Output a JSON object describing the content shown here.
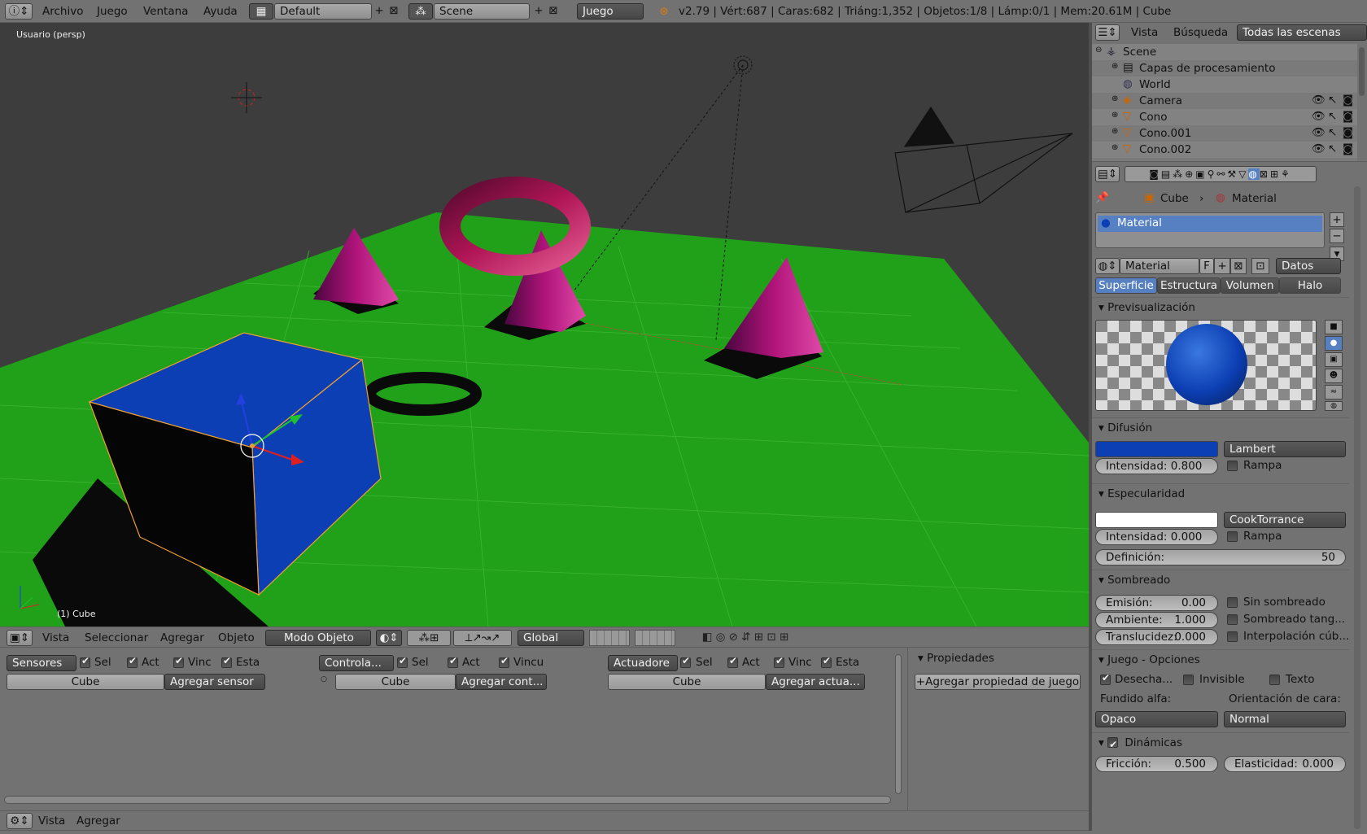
{
  "topbar": {
    "menus": [
      "Archivo",
      "Juego",
      "Ventana",
      "Ayuda"
    ],
    "layout": "Default",
    "scene": "Scene",
    "engine": "Juego",
    "stats": "v2.79 | Vért:687 | Caras:682 | Triáng:1,352 | Objetos:1/8 | Lámp:0/1 | Mem:20.61M | Cube"
  },
  "viewport": {
    "view_label": "Usuario (persp)",
    "object_label": "(1) Cube"
  },
  "view3d_header": {
    "menus": [
      "Vista",
      "Seleccionar",
      "Agregar",
      "Objeto"
    ],
    "mode": "Modo Objeto",
    "orientation": "Global"
  },
  "logic": {
    "sensors": {
      "type": "Sensores",
      "checks": [
        "Sel",
        "Act",
        "Vinc",
        "Esta"
      ],
      "object": "Cube",
      "add": "Agregar sensor"
    },
    "controllers": {
      "type": "Controla...",
      "checks": [
        "Sel",
        "Act",
        "Vincu"
      ],
      "object": "Cube",
      "add": "Agregar cont..."
    },
    "actuators": {
      "type": "Actuadore",
      "checks": [
        "Sel",
        "Act",
        "Vinc",
        "Esta"
      ],
      "object": "Cube",
      "add": "Agregar actua..."
    },
    "properties_title": "Propiedades",
    "add_property": "Agregar propiedad de juego"
  },
  "logic_header": {
    "menus": [
      "Vista",
      "Agregar"
    ]
  },
  "outliner": {
    "tabs": [
      "Vista",
      "Búsqueda",
      "Todas las escenas"
    ],
    "items": [
      {
        "label": "Scene"
      },
      {
        "label": "Capas de procesamiento"
      },
      {
        "label": "World"
      },
      {
        "label": "Camera"
      },
      {
        "label": "Cono"
      },
      {
        "label": "Cono.001"
      },
      {
        "label": "Cono.002"
      }
    ]
  },
  "properties": {
    "breadcrumb": [
      "Cube",
      "Material"
    ],
    "slot": "Material",
    "material_name": "Material",
    "fake_user": "F",
    "link": "Datos",
    "tabs": [
      "Superficie",
      "Estructura",
      "Volumen",
      "Halo"
    ],
    "preview": {
      "title": "Previsualización"
    },
    "diffuse": {
      "title": "Difusión",
      "color": "#0c3fb3",
      "shader": "Lambert",
      "intensity_label": "Intensidad:",
      "intensity": "0.800",
      "ramp": "Rampa"
    },
    "specular": {
      "title": "Especularidad",
      "color": "#ffffff",
      "shader": "CookTorrance",
      "intensity_label": "Intensidad:",
      "intensity": "0.000",
      "ramp": "Rampa",
      "hardness_label": "Definición:",
      "hardness": "50"
    },
    "shading": {
      "title": "Sombreado",
      "emit_label": "Emisión:",
      "emit": "0.00",
      "ambient_label": "Ambiente:",
      "ambient": "1.000",
      "translucency_label": "Translucidez:",
      "translucency": "0.000",
      "shadeless": "Sin sombreado",
      "tangent": "Sombreado tang...",
      "cubic": "Interpolación cúb..."
    },
    "game": {
      "title": "Juego - Opciones",
      "backface": "Desecha...",
      "invisible": "Invisible",
      "text": "Texto",
      "alpha_label": "Fundido alfa:",
      "alpha": "Opaco",
      "face_label": "Orientación de cara:",
      "face": "Normal"
    },
    "dynamics": {
      "title": "Dinámicas",
      "friction_label": "Fricción:",
      "friction": "0.500",
      "elasticity_label": "Elasticidad:",
      "elasticity": "0.000"
    }
  },
  "colors": {
    "ground": "#21a11a",
    "cube": "#0c3fb3",
    "cones": "#b0147a",
    "torus": "#b01556",
    "selection": "#f0a030"
  }
}
